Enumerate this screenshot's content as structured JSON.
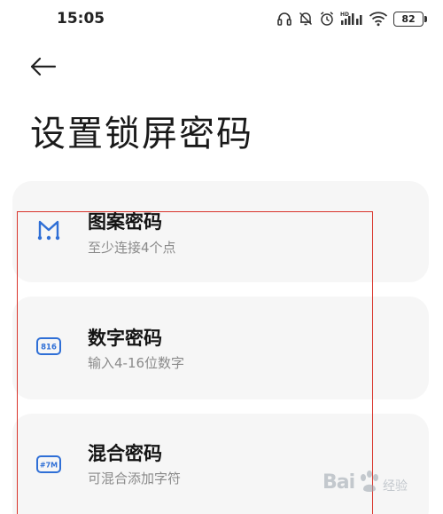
{
  "status_bar": {
    "time": "15:05",
    "battery_level": "82",
    "icons": [
      "headphones-icon",
      "bell-off-icon",
      "alarm-icon",
      "hd-signal-icon",
      "wifi-icon",
      "battery-icon"
    ]
  },
  "header": {
    "back_icon": "arrow-left-icon",
    "title": "设置锁屏密码"
  },
  "options": [
    {
      "icon": "pattern-icon",
      "title": "图案密码",
      "subtitle": "至少连接4个点"
    },
    {
      "icon": "numeric-pin-icon",
      "icon_text": "816",
      "title": "数字密码",
      "subtitle": "输入4-16位数字"
    },
    {
      "icon": "mixed-password-icon",
      "icon_text": "#7M",
      "title": "混合密码",
      "subtitle": "可混合添加字符"
    }
  ],
  "colors": {
    "accent": "#2f6fd6",
    "card_background": "#f6f6f6",
    "annotation_red": "#d9342b"
  }
}
